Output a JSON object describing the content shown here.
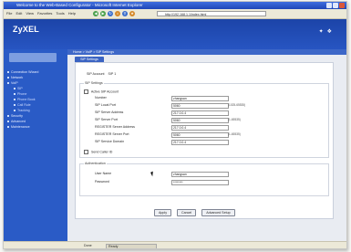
{
  "window": {
    "title": "Welcome to the Web-Based Configurator - Microsoft Internet Explorer"
  },
  "menu": [
    "File",
    "Edit",
    "View",
    "Favorites",
    "Tools",
    "Help"
  ],
  "address": {
    "label": "Address",
    "value": "http://192.168.1.1/index.html"
  },
  "brand": {
    "logo": "ZyXEL"
  },
  "breadcrumb": "Home > VoIP > SIP Settings",
  "sidebar": {
    "items": [
      {
        "label": "Connection Wizard",
        "sub": false
      },
      {
        "label": "Network",
        "sub": false
      },
      {
        "label": "VoIP",
        "sub": false
      },
      {
        "label": "SIP",
        "sub": true
      },
      {
        "label": "Phone",
        "sub": true
      },
      {
        "label": "Phone Book",
        "sub": true
      },
      {
        "label": "Call Rule",
        "sub": true
      },
      {
        "label": "Tracking",
        "sub": true
      },
      {
        "label": "Security",
        "sub": false
      },
      {
        "label": "Advanced",
        "sub": false
      },
      {
        "label": "Maintenance",
        "sub": false
      }
    ]
  },
  "tab": {
    "label": "SIP Settings"
  },
  "account": {
    "label": "SIP Account",
    "value": "SIP 1"
  },
  "sip_section": {
    "title": "SIP Settings",
    "active_label": "Active SIP Account",
    "fields": [
      {
        "label": "Number",
        "value": "zhangsan",
        "hint": ""
      },
      {
        "label": "SIP Local Port",
        "value": "5060",
        "hint": "(1025-65535)"
      },
      {
        "label": "SIP Server Address",
        "value": "217.0.0.4",
        "hint": ""
      },
      {
        "label": "SIP Server Port",
        "value": "5060",
        "hint": "(1-65535)"
      },
      {
        "label": "REGISTER Server Address",
        "value": "217.0.0.4",
        "hint": ""
      },
      {
        "label": "REGISTER Server Port",
        "value": "5060",
        "hint": "(1-65535)"
      },
      {
        "label": "SIP Service Domain",
        "value": "217.0.0.4",
        "hint": ""
      }
    ],
    "url_label": "Send Caller ID"
  },
  "auth_section": {
    "title": "Authentication",
    "fields": [
      {
        "label": "User Name",
        "value": "zhangsan"
      },
      {
        "label": "Password",
        "value": "********"
      }
    ]
  },
  "buttons": {
    "apply": "Apply",
    "cancel": "Cancel",
    "advanced": "Advanced Setup"
  },
  "status": {
    "done": "Done",
    "zone": "Ready"
  },
  "colors": {
    "header_blue": "#1c44a8",
    "sidebar_blue": "#2a5bc6",
    "panel_bg": "#ffffff"
  }
}
